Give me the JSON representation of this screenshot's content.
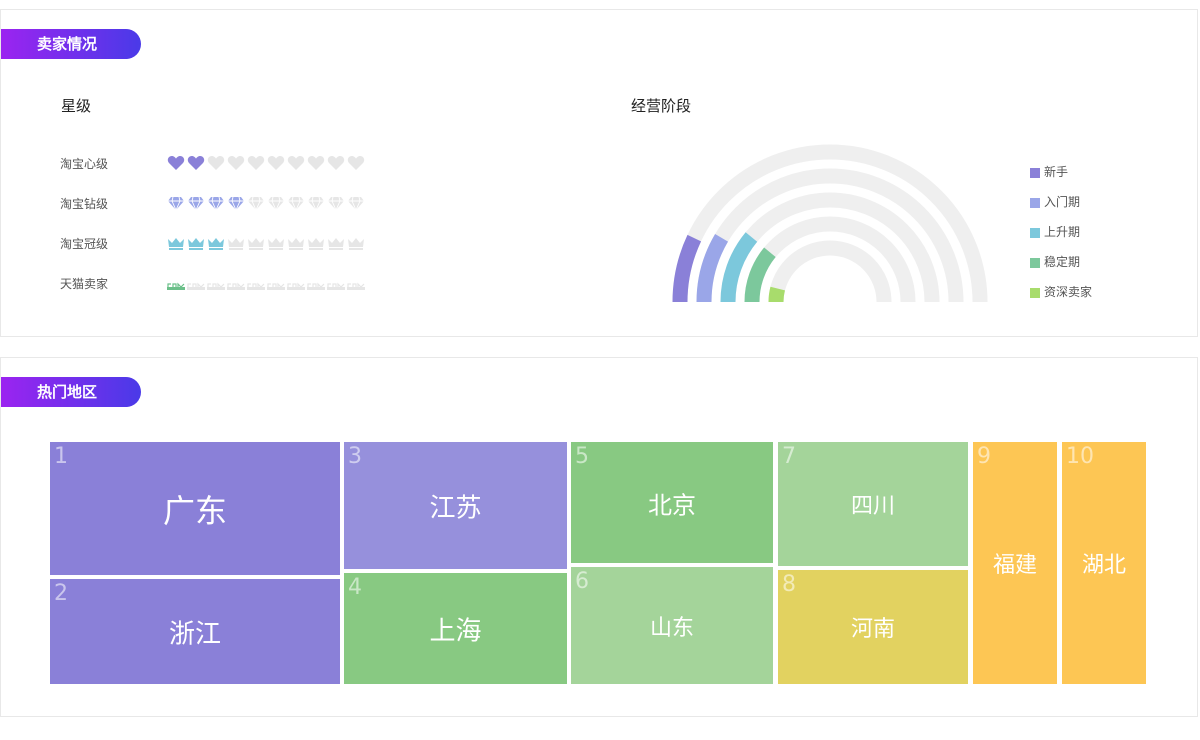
{
  "sellers": {
    "tag": "卖家情况",
    "rating_title": "星级",
    "stage_title": "经营阶段",
    "rating_rows": [
      {
        "label": "淘宝心级",
        "icon": "heart-icon",
        "filled": 2,
        "total": 10,
        "color": "#8a80d8"
      },
      {
        "label": "淘宝钻级",
        "icon": "diamond-icon",
        "filled": 4,
        "total": 10,
        "color": "#9aa6e8"
      },
      {
        "label": "淘宝冠级",
        "icon": "crown-icon",
        "filled": 3,
        "total": 10,
        "color": "#7cc8dc"
      },
      {
        "label": "天猫卖家",
        "icon": "tmall-icon",
        "filled": 1,
        "total": 10,
        "color": "#6cc08a"
      }
    ],
    "track_color": "#efefef",
    "chart_data": {
      "type": "radial-bar",
      "categories": [
        "新手",
        "入门期",
        "上升期",
        "稳定期",
        "资深卖家"
      ],
      "colors": [
        "#8a80d8",
        "#9aa6e8",
        "#7cc8dc",
        "#7cc89c",
        "#a8dc6c"
      ],
      "values": [
        0.14,
        0.17,
        0.22,
        0.22,
        0.08
      ],
      "legend_position": "right"
    }
  },
  "regions": {
    "tag": "热门地区",
    "chart_data": {
      "type": "treemap",
      "items": [
        {
          "rank": "1",
          "name": "广东",
          "color": "#8a80d8"
        },
        {
          "rank": "2",
          "name": "浙江",
          "color": "#8a80d8"
        },
        {
          "rank": "3",
          "name": "江苏",
          "color": "#9690dc"
        },
        {
          "rank": "4",
          "name": "上海",
          "color": "#88c982"
        },
        {
          "rank": "5",
          "name": "北京",
          "color": "#88c982"
        },
        {
          "rank": "6",
          "name": "山东",
          "color": "#a4d49a"
        },
        {
          "rank": "7",
          "name": "四川",
          "color": "#a4d49a"
        },
        {
          "rank": "8",
          "name": "河南",
          "color": "#e2d260"
        },
        {
          "rank": "9",
          "name": "福建",
          "color": "#fdc654"
        },
        {
          "rank": "10",
          "name": "湖北",
          "color": "#fdc654"
        }
      ]
    }
  }
}
